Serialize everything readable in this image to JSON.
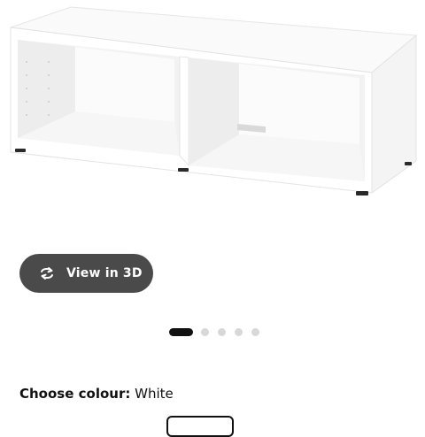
{
  "product": {
    "image_alt": "white TV bench"
  },
  "view3d": {
    "label": "View in 3D",
    "icon": "rotate-3d-icon"
  },
  "carousel": {
    "total": 5,
    "active_index": 0
  },
  "colour": {
    "label": "Choose colour:",
    "value": "White"
  },
  "colors": {
    "button_bg": "#4a4a4a",
    "dot_active": "#111111",
    "dot_inactive": "#d8d8d8"
  }
}
